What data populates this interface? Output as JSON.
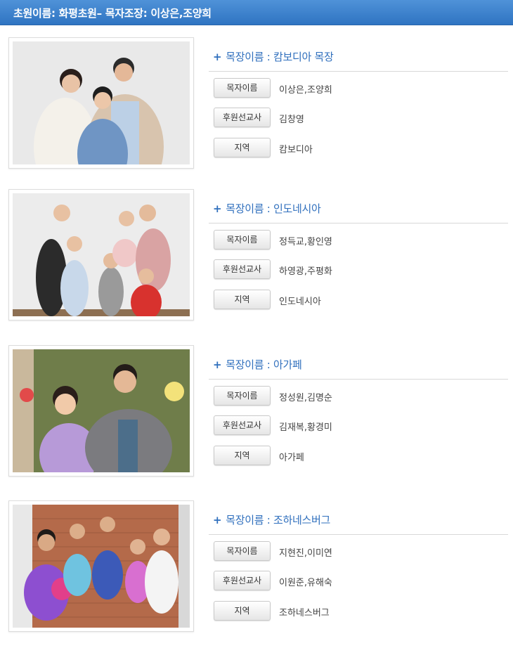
{
  "header": {
    "title": "초원이름: 화평초원– 목자조장: 이상은,조양희"
  },
  "labels": {
    "shepherd": "목자이름",
    "sponsor": "후원선교사",
    "region": "지역"
  },
  "cards": [
    {
      "title": "목장이름 : 캄보디아 목장",
      "shepherd": "이상은,조양희",
      "sponsor": "김창영",
      "region": "캄보디아"
    },
    {
      "title": "목장이름 : 인도네시아",
      "shepherd": "정득교,황인영",
      "sponsor": "하영광,주평화",
      "region": "인도네시아"
    },
    {
      "title": "목장이름 : 아가페",
      "shepherd": "정성원,김명순",
      "sponsor": "김재복,황경미",
      "region": "아가페"
    },
    {
      "title": "목장이름 : 조하네스버그",
      "shepherd": "지현진,이미연",
      "sponsor": "이원준,유해숙",
      "region": "조하네스버그"
    }
  ],
  "plus_glyph": "+"
}
